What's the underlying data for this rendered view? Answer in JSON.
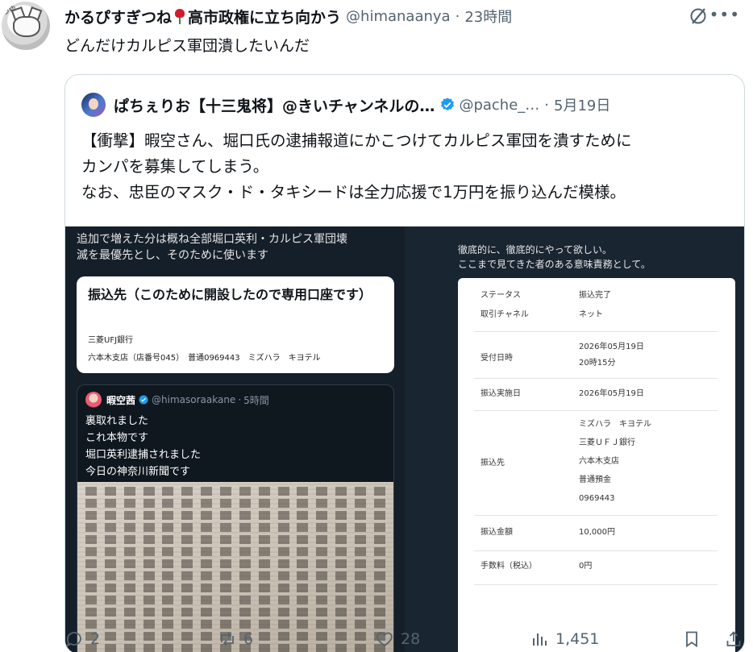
{
  "tweet": {
    "display_name": "かるぴすぎつね",
    "name_suffix": "高市政権に立ち向かう",
    "handle": "@himanaanya",
    "separator": "·",
    "time": "23時間",
    "text": "どんだけカルピス軍団潰したいんだ",
    "avatar_tag": "つゆ"
  },
  "quote": {
    "display_name": "ぱちぇりお【十三鬼将】@きいチャンネルの…",
    "handle": "@pache_…",
    "separator": "·",
    "date": "5月19日",
    "lines": [
      "【衝撃】暇空さん、堀口氏の逮捕報道にかこつけてカルピス軍団を潰すために",
      "カンパを募集してしまう。",
      "なお、忠臣のマスク・ド・タキシードは全力応援で1万円を振り込んだ模様。"
    ]
  },
  "left_image": {
    "intro_lines": [
      "追加で増えた分は概ね全部堀口英利・カルピス軍団壊",
      "滅を最優先とし、そのために使います"
    ],
    "card_title": "振込先（このために開設したので専用口座です）",
    "bank": "三菱UFJ銀行",
    "account": "六本木支店（店番号045）　普通0969443　ミズハラ　キヨテル",
    "inner_tweet": {
      "name": "暇空茜",
      "handle": "@himasoraakane",
      "separator": "·",
      "time": "5時間",
      "lines": [
        "裏取れました",
        "これ本物です",
        "堀口英利逮捕されました",
        "今日の神奈川新聞です"
      ]
    }
  },
  "right_image": {
    "intro_lines": [
      "徹底的に、徹底的にやって欲しい。",
      "ここまで見てきた者のある意味責務として。"
    ],
    "receipt": {
      "status_label": "ステータス",
      "status_value": "振込完了",
      "channel_label": "取引チャネル",
      "channel_value": "ネット",
      "received_label": "受付日時",
      "received_date": "2026年05月19日",
      "received_time": "20時15分",
      "exec_label": "振込実施日",
      "exec_value": "2026年05月19日",
      "payee_label": "振込先",
      "payee_lines": [
        "ミズハラ　キヨテル",
        "三菱ＵＦＪ銀行",
        "六本木支店",
        "普通預金",
        "0969443"
      ],
      "amount_label": "振込金額",
      "amount_value": "10,000円",
      "fee_label": "手数料（税込）",
      "fee_value": "0円"
    }
  },
  "actions": {
    "replies": "2",
    "reposts": "6",
    "likes": "28",
    "views": "1,451"
  },
  "icons": {
    "verified_color": "#1d9bf0",
    "rose": "rose-icon",
    "grok": "grok-slash-icon",
    "more": "more-icon"
  }
}
